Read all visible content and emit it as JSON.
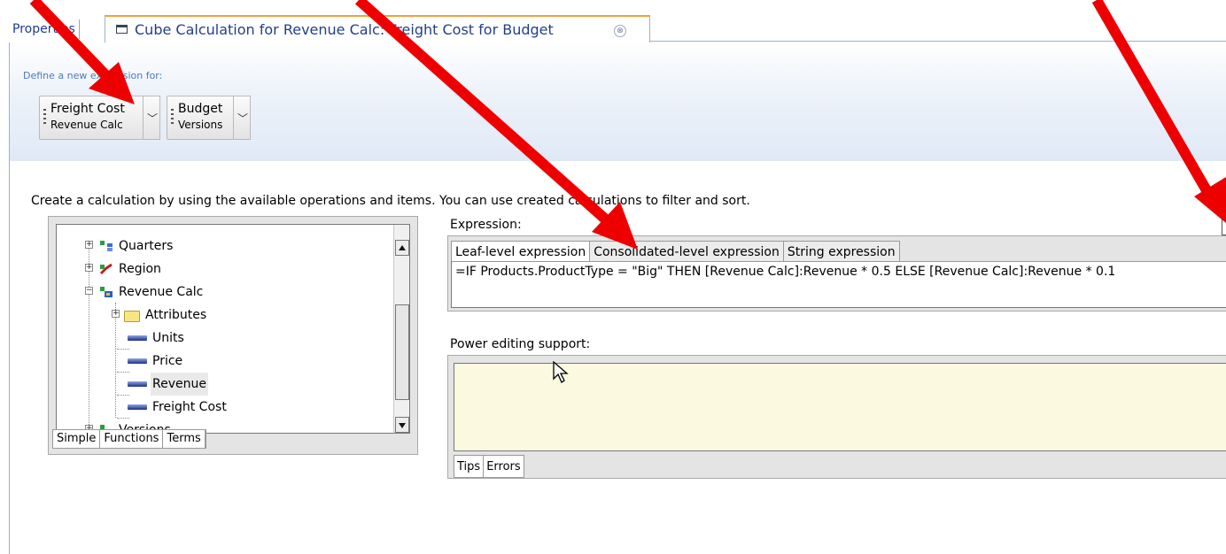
{
  "tabs": {
    "properties_label": "Properties",
    "active_label": "Cube Calculation for Revenue Calc: Freight Cost for Budget",
    "close_glyph": "⊗"
  },
  "header": {
    "define_label": "Define a new expression for:",
    "selectors": [
      {
        "main": "Freight Cost",
        "sub": "Revenue Calc"
      },
      {
        "main": "Budget",
        "sub": "Versions"
      }
    ]
  },
  "instruction": "Create a calculation by using the available operations and items. You can use created calculations to filter and sort.",
  "tree": {
    "items": [
      {
        "label": "Quarters",
        "icon": "dimension-hierarchy-icon"
      },
      {
        "label": "Region",
        "icon": "dimension-icon"
      },
      {
        "label": "Revenue Calc",
        "icon": "cube-calc-icon"
      },
      {
        "label": "Attributes",
        "icon": "folder-icon"
      },
      {
        "label": "Units",
        "icon": "measure-icon"
      },
      {
        "label": "Price",
        "icon": "measure-icon"
      },
      {
        "label": "Revenue",
        "icon": "measure-icon",
        "selected": true
      },
      {
        "label": "Freight Cost",
        "icon": "measure-icon"
      },
      {
        "label": "Versions",
        "icon": "dimension-icon"
      }
    ],
    "tabs": [
      "Simple",
      "Functions",
      "Terms"
    ],
    "active_tab": "Terms"
  },
  "expression": {
    "label": "Expression:",
    "tabs": [
      "Leaf-level expression",
      "Consolidated-level expression",
      "String expression"
    ],
    "active_tab": "Leaf-level expression",
    "text": "=IF Products.ProductType = \"Big\" THEN [Revenue Calc]:Revenue * 0.5 ELSE  [Revenue Calc]:Revenue * 0.1"
  },
  "power_editing": {
    "label": "Power editing support:",
    "tabs": [
      "Tips",
      "Errors"
    ],
    "active_tab": "Errors"
  },
  "colors": {
    "arrow": "#ee0000",
    "accent_tab": "#f2a13a",
    "link_blue": "#213f8a",
    "power_bg": "#fbfae0"
  }
}
